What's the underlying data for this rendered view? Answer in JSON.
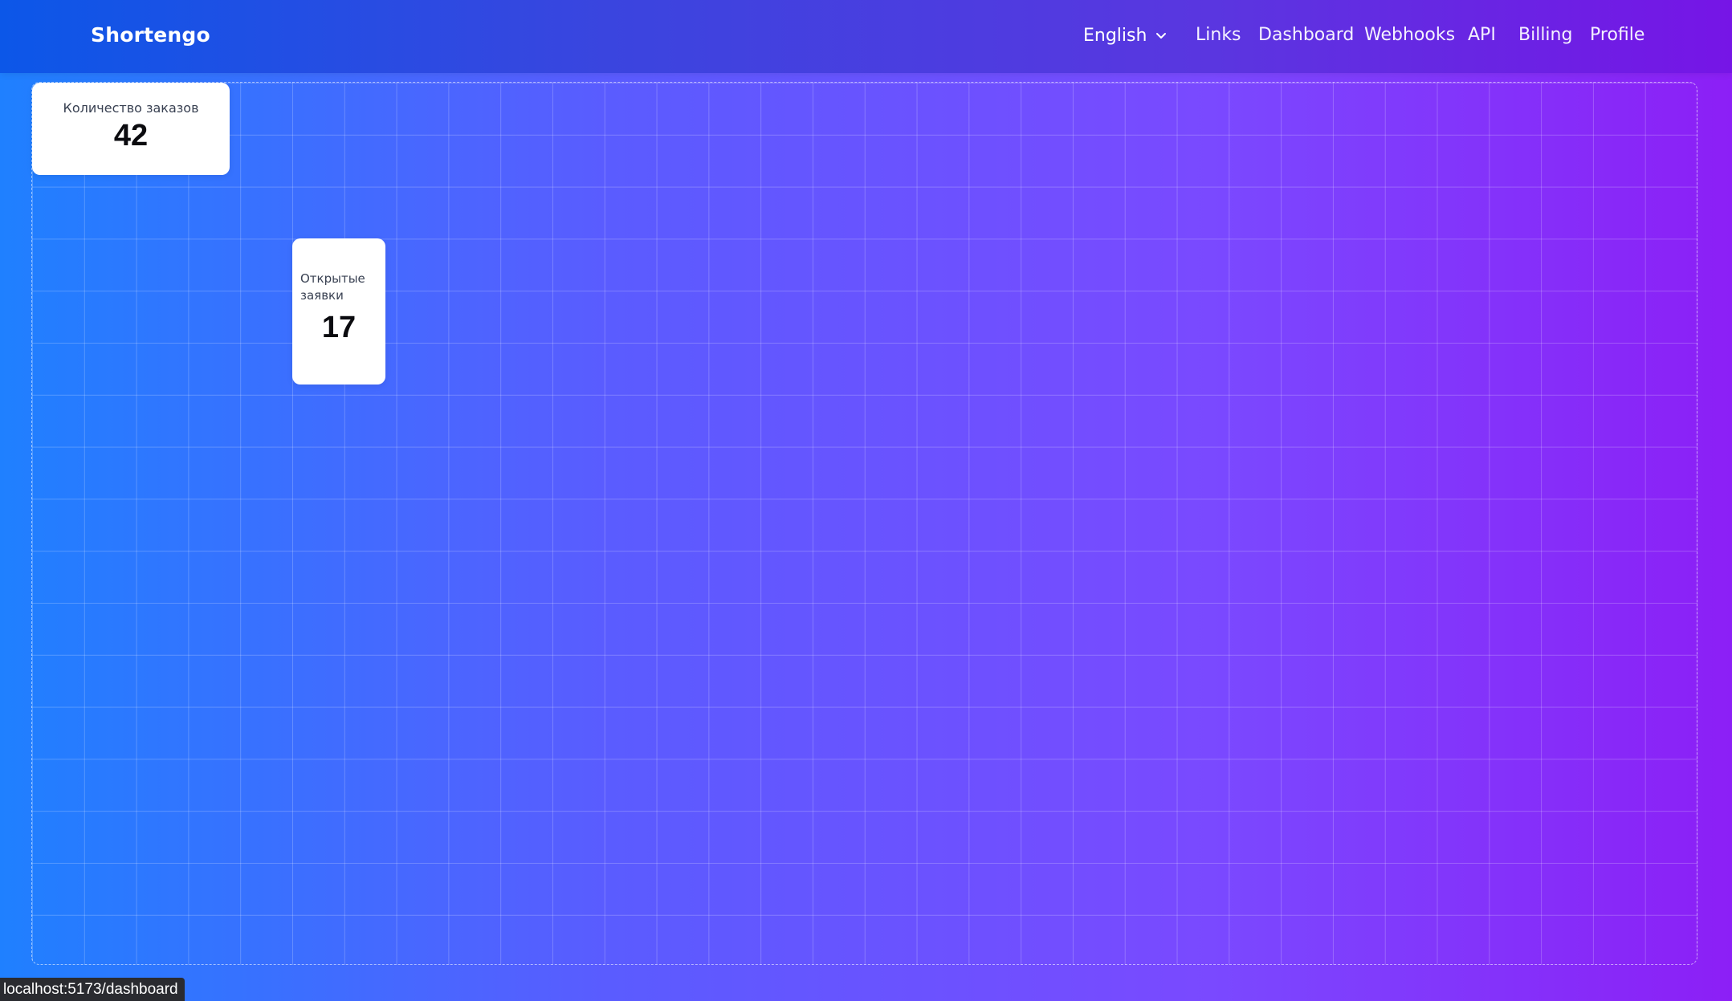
{
  "app": {
    "brand": "Shortengo"
  },
  "header": {
    "language": {
      "selected": "English",
      "icon": "chevron-down-icon"
    },
    "nav": [
      {
        "label": "Links"
      },
      {
        "label": "Dashboard"
      },
      {
        "label": "Webhooks"
      },
      {
        "label": "API"
      },
      {
        "label": "Billing"
      },
      {
        "label": "Profile"
      }
    ]
  },
  "dashboard": {
    "widgets": [
      {
        "label": "Количество заказов",
        "value": "42"
      },
      {
        "label": "Открытые заявки",
        "value": "17"
      }
    ]
  },
  "status_bar": {
    "url": "localhost:5173/dashboard"
  },
  "colors": {
    "header_gradient": [
      "#0c57e8",
      "#7615e6"
    ],
    "background_gradient": [
      "#1f80ff",
      "#8c1ff6"
    ],
    "card": "#ffffff"
  }
}
